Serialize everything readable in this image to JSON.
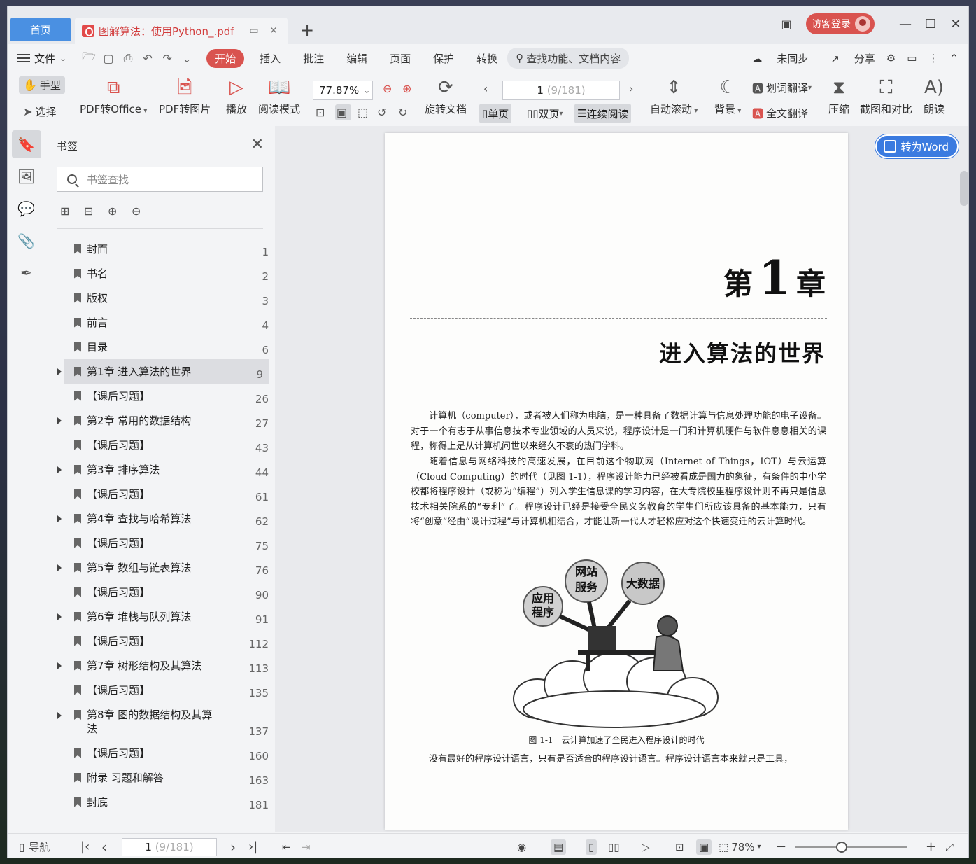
{
  "tabs": {
    "home": "首页",
    "doc_title": "图解算法：使用Python_.pdf"
  },
  "titlebar": {
    "guest_login": "访客登录"
  },
  "menu": {
    "file": "文件",
    "items": [
      "开始",
      "插入",
      "批注",
      "编辑",
      "页面",
      "保护",
      "转换"
    ],
    "search_placeholder": "查找功能、文档内容",
    "sync": "未同步",
    "share": "分享"
  },
  "ribbon": {
    "hand": "手型",
    "select": "选择",
    "pdf_to_office": "PDF转Office",
    "pdf_to_image": "PDF转图片",
    "play": "播放",
    "read_mode": "阅读模式",
    "zoom": "77.87%",
    "page_current": "1",
    "page_total": "(9/181)",
    "rotate_doc": "旋转文档",
    "single_page": "单页",
    "double_page": "双页",
    "continuous": "连续阅读",
    "auto_scroll": "自动滚动",
    "background": "背景",
    "word_translate": "划词翻译",
    "full_translate": "全文翻译",
    "compress": "压缩",
    "screenshot_compare": "截图和对比",
    "read_aloud": "朗读"
  },
  "bookmarks": {
    "title": "书签",
    "search_placeholder": "书签查找",
    "items": [
      {
        "label": "封面",
        "page": "1"
      },
      {
        "label": "书名",
        "page": "2"
      },
      {
        "label": "版权",
        "page": "3"
      },
      {
        "label": "前言",
        "page": "4"
      },
      {
        "label": "目录",
        "page": "6"
      },
      {
        "label": "第1章 进入算法的世界",
        "page": "9"
      },
      {
        "label": "【课后习题】",
        "page": "26"
      },
      {
        "label": "第2章 常用的数据结构",
        "page": "27"
      },
      {
        "label": "【课后习题】",
        "page": "43"
      },
      {
        "label": "第3章 排序算法",
        "page": "44"
      },
      {
        "label": "【课后习题】",
        "page": "61"
      },
      {
        "label": "第4章 查找与哈希算法",
        "page": "62"
      },
      {
        "label": "【课后习题】",
        "page": "75"
      },
      {
        "label": "第5章 数组与链表算法",
        "page": "76"
      },
      {
        "label": "【课后习题】",
        "page": "90"
      },
      {
        "label": "第6章 堆栈与队列算法",
        "page": "91"
      },
      {
        "label": "【课后习题】",
        "page": "112"
      },
      {
        "label": "第7章 树形结构及其算法",
        "page": "113"
      },
      {
        "label": "【课后习题】",
        "page": "135"
      },
      {
        "label": "第8章 图的数据结构及其算法",
        "page": "137"
      },
      {
        "label": "【课后习题】",
        "page": "160"
      },
      {
        "label": "附录 习题和解答",
        "page": "163"
      },
      {
        "label": "封底",
        "page": "181"
      }
    ]
  },
  "document": {
    "to_word": "转为Word",
    "chapter_prefix": "第",
    "chapter_num": "1",
    "chapter_suffix": "章",
    "chapter_title": "进入算法的世界",
    "para1": "计算机（computer），或者被人们称为电脑，是一种具备了数据计算与信息处理功能的电子设备。对于一个有志于从事信息技术专业领域的人员来说，程序设计是一门和计算机硬件与软件息息相关的课程，称得上是从计算机问世以来经久不衰的热门学科。",
    "para2": "随着信息与网络科技的高速发展，在目前这个物联网（Internet of Things，IOT）与云运算（Cloud Computing）的时代（见图 1-1），程序设计能力已经被看成是国力的象征，有条件的中小学校都将程序设计（或称为“编程”）列入学生信息课的学习内容，在大专院校里程序设计则不再只是信息技术相关院系的“专利”了。程序设计已经是接受全民义务教育的学生们所应该具备的基本能力，只有将“创意”经由“设计过程”与计算机相结合，才能让新一代人才轻松应对这个快速变迁的云计算时代。",
    "bubble_web_1": "网站",
    "bubble_web_2": "服务",
    "bubble_bigdata": "大数据",
    "bubble_app_1": "应用",
    "bubble_app_2": "程序",
    "caption": "图 1-1　云计算加速了全民进入程序设计的时代",
    "para3": "没有最好的程序设计语言，只有是否适合的程序设计语言。程序设计语言本来就只是工具，"
  },
  "statusbar": {
    "nav": "导航",
    "page_current": "1",
    "page_total": "(9/181)",
    "zoom": "78%"
  }
}
